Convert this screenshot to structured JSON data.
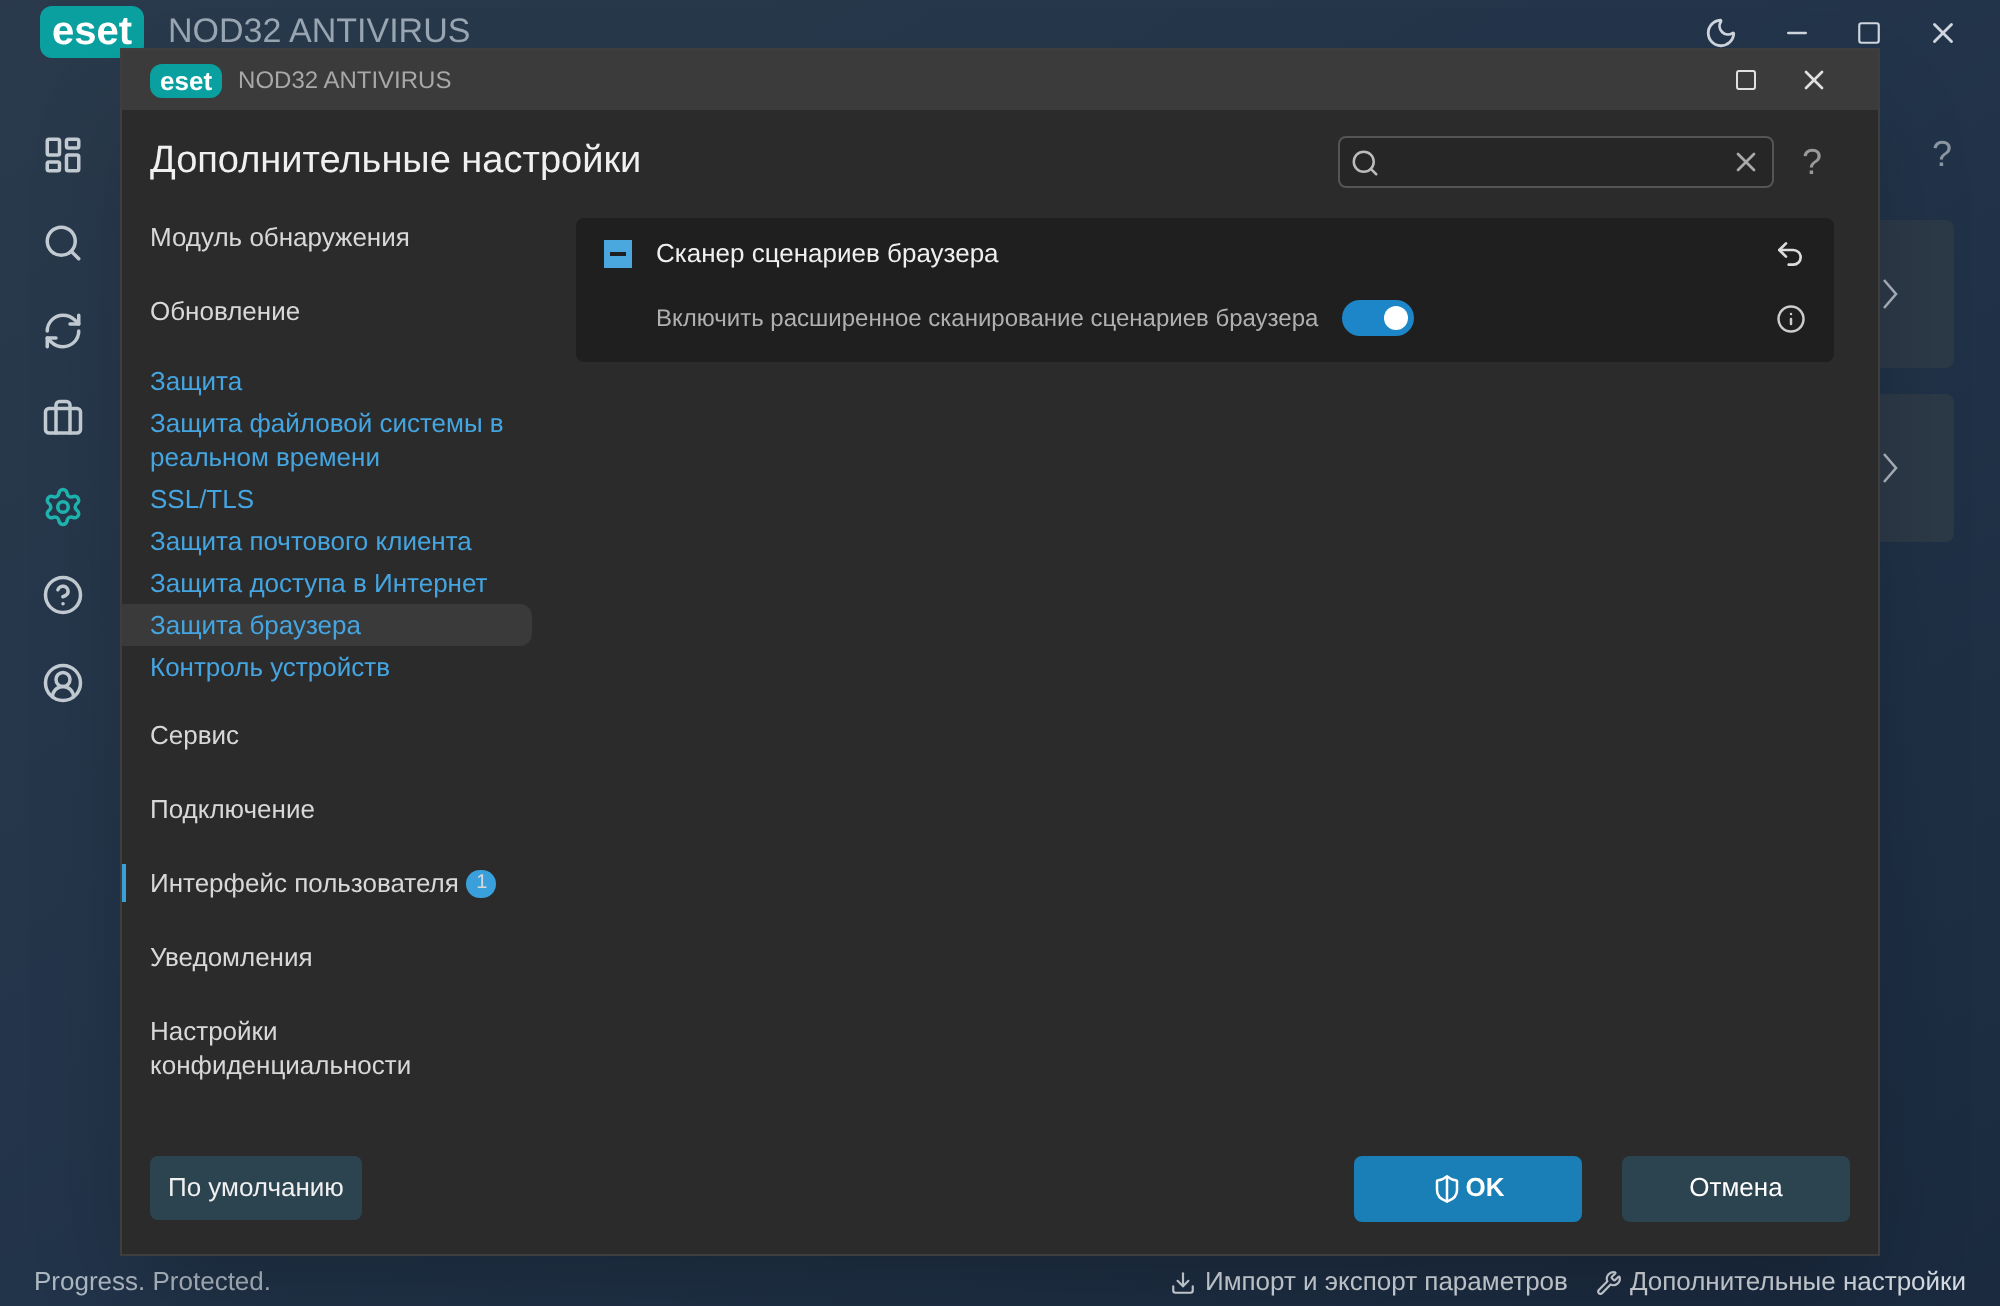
{
  "background_app": {
    "brand": "eset",
    "product": "NOD32 ANTIVIRUS",
    "sidebar": [
      {
        "selected": false
      },
      {
        "selected": false
      },
      {
        "selected": false
      },
      {
        "selected": false
      },
      {
        "selected": true
      },
      {
        "selected": false
      },
      {
        "selected": false
      }
    ],
    "help": "?",
    "status": "Progress. Protected.",
    "footer_links": [
      "Импорт и экспорт параметров",
      "Дополнительные настройки"
    ]
  },
  "dialog": {
    "brand": "eset",
    "product": "NOD32 ANTIVIRUS",
    "title": "Дополнительные настройки",
    "help": "?",
    "nav": [
      {
        "kind": "section",
        "label": "Модуль обнаружения",
        "selected": false,
        "accent": false
      },
      {
        "kind": "section",
        "label": "Обновление",
        "selected": false,
        "accent": false
      },
      {
        "kind": "link",
        "label": "Защита",
        "selected": false,
        "accent": false
      },
      {
        "kind": "link",
        "label": "Защита файловой системы в реальном времени",
        "selected": false,
        "accent": false
      },
      {
        "kind": "link",
        "label": "SSL/TLS",
        "selected": false,
        "accent": false
      },
      {
        "kind": "link",
        "label": "Защита почтового клиента",
        "selected": false,
        "accent": false
      },
      {
        "kind": "link",
        "label": "Защита доступа в Интернет",
        "selected": false,
        "accent": false
      },
      {
        "kind": "link",
        "label": "Защита браузера",
        "selected": true,
        "accent": false
      },
      {
        "kind": "link",
        "label": "Контроль устройств",
        "selected": false,
        "accent": false
      },
      {
        "kind": "section",
        "label": "Сервис",
        "selected": false,
        "accent": false
      },
      {
        "kind": "section",
        "label": "Подключение",
        "selected": false,
        "accent": false
      },
      {
        "kind": "section",
        "label": "Интерфейс пользователя",
        "selected": false,
        "accent": true,
        "badge": "1"
      },
      {
        "kind": "section",
        "label": "Уведомления",
        "selected": false,
        "accent": false
      },
      {
        "kind": "section",
        "label": "Настройки конфиденциальности",
        "selected": false,
        "accent": false
      }
    ],
    "panel": {
      "title": "Сканер сценариев браузера",
      "expanded": true,
      "rows": [
        {
          "label": "Включить расширенное сканирование сценариев браузера",
          "on": true
        }
      ]
    },
    "buttons": {
      "default": "По умолчанию",
      "ok": "OK",
      "cancel": "Отмена"
    }
  }
}
